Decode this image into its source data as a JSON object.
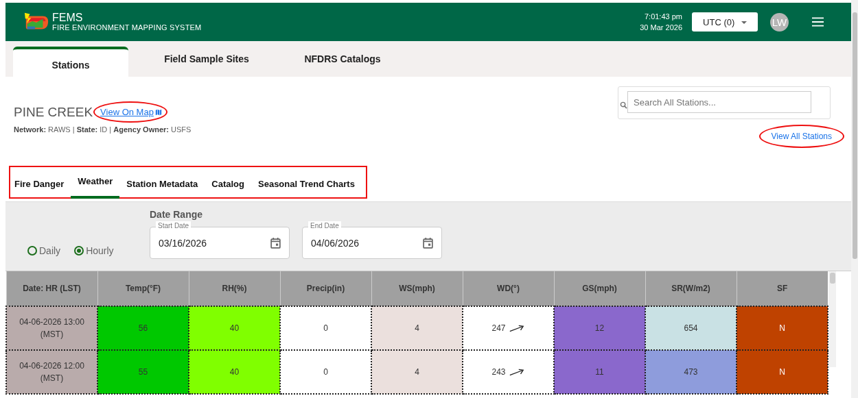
{
  "header": {
    "app_name": "FEMS",
    "app_subtitle": "FIRE ENVIRONMENT MAPPING SYSTEM",
    "time": "7:01:43 pm",
    "date": "30 Mar 2026",
    "timezone": "UTC (0)",
    "avatar_initials": "LW"
  },
  "main_tabs": [
    {
      "label": "Stations",
      "selected": true
    },
    {
      "label": "Field Sample Sites",
      "selected": false
    },
    {
      "label": "NFDRS Catalogs",
      "selected": false
    }
  ],
  "station": {
    "name": "PINE CREEK",
    "map_link": {
      "label": "View On Map",
      "circled": true
    },
    "details": "**Network:** RAWS | **State:** ID | **Agency Owner:** USFS"
  },
  "search": {
    "placeholder": "Search All Stations..."
  },
  "view_all": {
    "label": "View All Stations",
    "circled": true
  },
  "station_tabs": {
    "outlined": true,
    "items": [
      {
        "label": "Fire Danger",
        "selected": false
      },
      {
        "label": "Weather",
        "selected": true
      },
      {
        "label": "Station Metadata",
        "selected": false
      },
      {
        "label": "Catalog",
        "selected": false
      },
      {
        "label": "Seasonal Trend Charts",
        "selected": false
      }
    ]
  },
  "interval": [
    {
      "label": "Daily",
      "selected": false
    },
    {
      "label": "Hourly",
      "selected": true
    }
  ],
  "date_range": {
    "title": "Date Range",
    "start": {
      "label": "Start Date",
      "value": "03/16/2026"
    },
    "end": {
      "label": "End Date",
      "value": "04/06/2026"
    }
  },
  "table": {
    "columns": [
      "Date: HR (LST)",
      "Temp(°F)",
      "RH(%)",
      "Precip(in)",
      "WS(mph)",
      "WD(°)",
      "GS(mph)",
      "SR(W/m2)",
      "SF"
    ],
    "rows": [
      {
        "cells": [
          {
            "text": "04-06-2026 13:00 (MST)",
            "color": "#b9abab"
          },
          {
            "text": "56",
            "color": "#00c800"
          },
          {
            "text": "40",
            "color": "#80ff00"
          },
          {
            "text": "0",
            "color": "#ffffff"
          },
          {
            "text": "4",
            "color": "#ebe0dd"
          },
          {
            "text": "247",
            "color": "#ffffff",
            "kind": "direction"
          },
          {
            "text": "12",
            "color": "#8a68cc"
          },
          {
            "text": "654",
            "color": "#c9e1e4"
          },
          {
            "text": "N",
            "color": "#bf4200",
            "kind": "light"
          }
        ]
      },
      {
        "cells": [
          {
            "text": "04-06-2026 12:00 (MST)",
            "color": "#b9abab"
          },
          {
            "text": "55",
            "color": "#00c800"
          },
          {
            "text": "40",
            "color": "#80ff00"
          },
          {
            "text": "0",
            "color": "#ffffff"
          },
          {
            "text": "4",
            "color": "#ebe0dd"
          },
          {
            "text": "243",
            "color": "#ffffff",
            "kind": "direction"
          },
          {
            "text": "11",
            "color": "#8a68cc"
          },
          {
            "text": "473",
            "color": "#8e9cdc"
          },
          {
            "text": "N",
            "color": "#bf4200",
            "kind": "light"
          }
        ]
      }
    ]
  }
}
